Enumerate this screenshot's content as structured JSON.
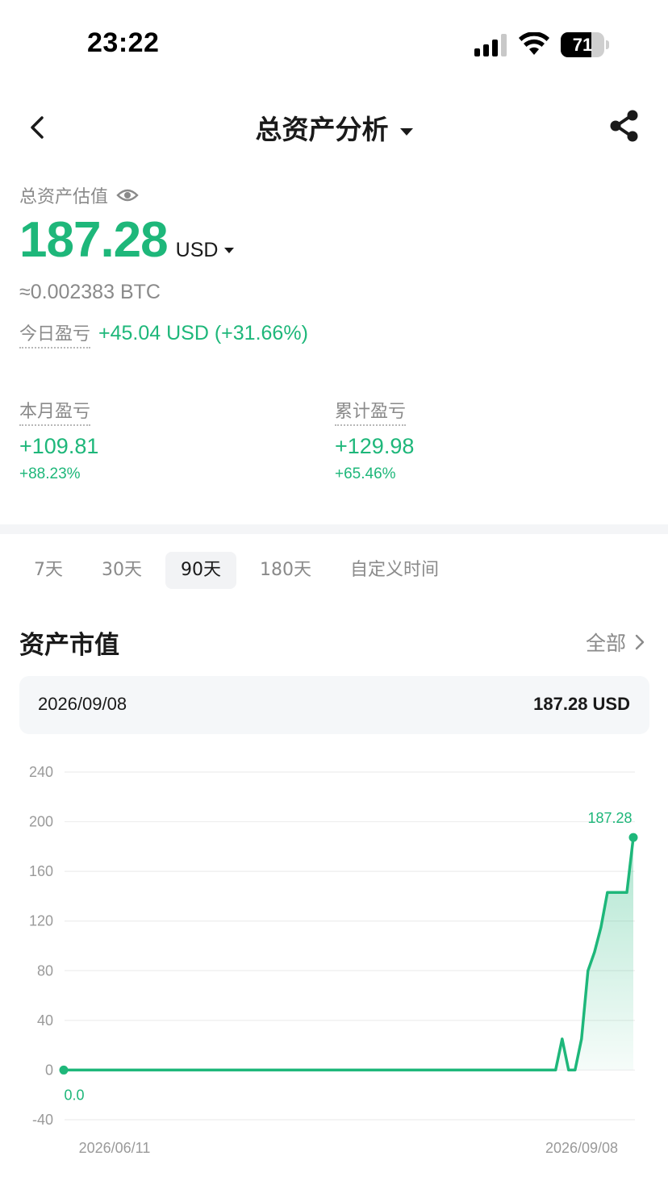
{
  "status_bar": {
    "time": "23:22",
    "battery": "71",
    "battery_level": 0.71
  },
  "nav": {
    "title": "总资产分析"
  },
  "summary": {
    "label": "总资产估值",
    "total_value": "187.28",
    "currency": "USD",
    "btc_equiv": "≈0.002383 BTC",
    "today_label": "今日盈亏",
    "today_value": "+45.04 USD (+31.66%)"
  },
  "pnl": {
    "month": {
      "label": "本月盈亏",
      "value": "+109.81",
      "pct": "+88.23%"
    },
    "cumulative": {
      "label": "累计盈亏",
      "value": "+129.98",
      "pct": "+65.46%"
    }
  },
  "tabs": [
    {
      "label": "7天",
      "active": false
    },
    {
      "label": "30天",
      "active": false
    },
    {
      "label": "90天",
      "active": true
    },
    {
      "label": "180天",
      "active": false
    },
    {
      "label": "自定义时间",
      "active": false
    }
  ],
  "section": {
    "title": "资产市值",
    "all_label": "全部"
  },
  "info_card": {
    "date": "2026/09/08",
    "value": "187.28 USD"
  },
  "colors": {
    "accent": "#1eb77a",
    "grid": "#eeeeee",
    "axis_text": "#9a9a9a"
  },
  "chart_data": {
    "type": "area",
    "x_start_label": "2026/06/11",
    "x_end_label": "2026/09/08",
    "ylim": [
      -40,
      240
    ],
    "yticks": [
      240,
      200,
      160,
      120,
      80,
      40,
      0,
      -40
    ],
    "start_label": "0.0",
    "end_label": "187.28",
    "series": [
      {
        "values": [
          0,
          0,
          0,
          0,
          0,
          0,
          0,
          0,
          0,
          0,
          0,
          0,
          0,
          0,
          0,
          0,
          0,
          0,
          0,
          0,
          0,
          0,
          0,
          0,
          0,
          0,
          0,
          0,
          0,
          0,
          0,
          0,
          0,
          0,
          0,
          0,
          0,
          0,
          0,
          0,
          0,
          0,
          0,
          0,
          0,
          0,
          0,
          0,
          0,
          0,
          0,
          0,
          0,
          0,
          0,
          0,
          0,
          0,
          0,
          0,
          0,
          0,
          0,
          0,
          0,
          0,
          0,
          0,
          0,
          0,
          0,
          0,
          0,
          0,
          0,
          0,
          0,
          25,
          0,
          0,
          25,
          80,
          95,
          115,
          143,
          143,
          143,
          143,
          187.28
        ]
      }
    ]
  }
}
